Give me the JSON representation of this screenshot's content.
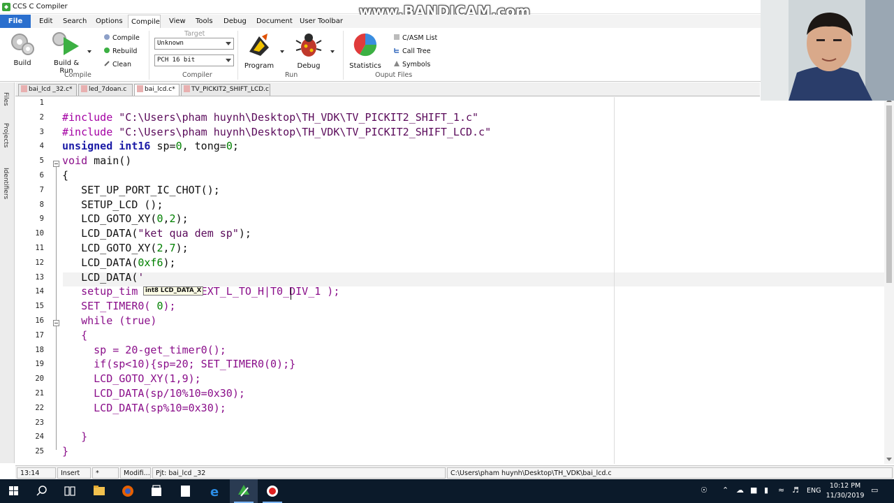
{
  "window": {
    "title": "CCS C Compiler",
    "watermark": "www.BANDICAM.com"
  },
  "menu": {
    "items": [
      {
        "label": "File"
      },
      {
        "label": "Edit"
      },
      {
        "label": "Search"
      },
      {
        "label": "Options"
      },
      {
        "label": "Compile"
      },
      {
        "label": "View"
      },
      {
        "label": "Tools"
      },
      {
        "label": "Debug"
      },
      {
        "label": "Document"
      },
      {
        "label": "User Toolbar"
      }
    ],
    "active": "Compile"
  },
  "ribbon": {
    "build": "Build",
    "build_run": "Build & Run",
    "compile": "Compile",
    "rebuild": "Rebuild",
    "clean": "Clean",
    "group_compile": "Compile",
    "target_label": "Target",
    "target_value": "Unknown",
    "compiler_value": "PCH 16 bit",
    "group_compiler": "Compiler",
    "program": "Program",
    "debug": "Debug",
    "group_run": "Run",
    "statistics": "Statistics",
    "casm_list": "C/ASM List",
    "call_tree": "Call Tree",
    "symbols": "Symbols",
    "group_output": "Ouput Files"
  },
  "tabs": [
    {
      "label": "bai_lcd _32.c*"
    },
    {
      "label": "led_7doan.c"
    },
    {
      "label": "bai_lcd.c*"
    },
    {
      "label": "TV_PICKIT2_SHIFT_LCD.c"
    }
  ],
  "dock": {
    "files": "Files",
    "projects": "Projects",
    "identifiers": "Identifiers"
  },
  "editor": {
    "line_numbers": [
      "1",
      "2",
      "3",
      "4",
      "5",
      "6",
      "7",
      "8",
      "9",
      "10",
      "11",
      "12",
      "13",
      "14",
      "15",
      "16",
      "17",
      "18",
      "19",
      "20",
      "21",
      "22",
      "23",
      "24",
      "25"
    ],
    "lines": [
      [],
      [
        {
          "c": "pp",
          "t": "#include "
        },
        {
          "c": "str",
          "t": "\"C:\\Users\\pham huynh\\Desktop\\TH_VDK\\TV_PICKIT2_SHIFT_1.c\""
        }
      ],
      [
        {
          "c": "pp",
          "t": "#include "
        },
        {
          "c": "str",
          "t": "\"C:\\Users\\pham huynh\\Desktop\\TH_VDK\\TV_PICKIT2_SHIFT_LCD.c\""
        }
      ],
      [
        {
          "c": "kw",
          "t": "unsigned int16"
        },
        {
          "c": "fn",
          "t": " sp="
        },
        {
          "c": "num",
          "t": "0"
        },
        {
          "c": "fn",
          "t": ", tong="
        },
        {
          "c": "num",
          "t": "0"
        },
        {
          "c": "fn",
          "t": ";"
        }
      ],
      [
        {
          "c": "mg",
          "t": "void"
        },
        {
          "c": "fn",
          "t": " main()"
        }
      ],
      [
        {
          "c": "fn",
          "t": "{"
        }
      ],
      [
        {
          "c": "fn",
          "t": "   SET_UP_PORT_IC_CHOT();"
        }
      ],
      [
        {
          "c": "fn",
          "t": "   SETUP_LCD ();"
        }
      ],
      [
        {
          "c": "fn",
          "t": "   LCD_GOTO_XY("
        },
        {
          "c": "num",
          "t": "0"
        },
        {
          "c": "fn",
          "t": ","
        },
        {
          "c": "num",
          "t": "2"
        },
        {
          "c": "fn",
          "t": ");"
        }
      ],
      [
        {
          "c": "fn",
          "t": "   LCD_DATA("
        },
        {
          "c": "str",
          "t": "\"ket qua dem sp\""
        },
        {
          "c": "fn",
          "t": ");"
        }
      ],
      [
        {
          "c": "fn",
          "t": "   LCD_GOTO_XY("
        },
        {
          "c": "num",
          "t": "2"
        },
        {
          "c": "fn",
          "t": ","
        },
        {
          "c": "num",
          "t": "7"
        },
        {
          "c": "fn",
          "t": ");"
        }
      ],
      [
        {
          "c": "fn",
          "t": "   LCD_DATA("
        },
        {
          "c": "num",
          "t": "0xf6"
        },
        {
          "c": "fn",
          "t": ");"
        }
      ],
      [
        {
          "c": "fn",
          "t": "   LCD_DATA("
        },
        {
          "c": "str",
          "t": "'"
        }
      ],
      [
        {
          "c": "mg",
          "t": "   setup_tim"
        },
        {
          "c": "mg",
          "t": "          EXT_L_TO_H|T0_DIV_1 );"
        }
      ],
      [
        {
          "c": "mg",
          "t": "   SET_TIMER0( "
        },
        {
          "c": "num",
          "t": "0"
        },
        {
          "c": "mg",
          "t": ");"
        }
      ],
      [
        {
          "c": "mg",
          "t": "   while (true)"
        }
      ],
      [
        {
          "c": "mg",
          "t": "   {"
        }
      ],
      [
        {
          "c": "mg",
          "t": "     sp = 20-get_timer0();"
        }
      ],
      [
        {
          "c": "mg",
          "t": "     if(sp<10){sp=20; SET_TIMER0(0);}"
        }
      ],
      [
        {
          "c": "mg",
          "t": "     LCD_GOTO_XY(1,9);"
        }
      ],
      [
        {
          "c": "mg",
          "t": "     LCD_DATA(sp/10%10=0x30);"
        }
      ],
      [
        {
          "c": "mg",
          "t": "     LCD_DATA(sp%10=0x30);"
        }
      ],
      [],
      [
        {
          "c": "mg",
          "t": "   }"
        }
      ],
      [
        {
          "c": "mg",
          "t": "}"
        }
      ]
    ],
    "tooltip": "int8 LCD_DATA_X"
  },
  "status": {
    "position": "13:14",
    "mode": "Insert",
    "modified_flag": "*",
    "modified": "Modifi...",
    "project": "Pjt: bai_lcd _32",
    "path": "C:\\Users\\pham huynh\\Desktop\\TH_VDK\\bai_lcd.c"
  },
  "taskbar": {
    "lang": "ENG",
    "time": "10:12 PM",
    "date": "11/30/2019"
  },
  "colors": {
    "accent": "#2a6fce",
    "preprocessor": "#a300a3",
    "keyword": "#1a1aa6",
    "number": "#008000",
    "taskbar": "#0b1a2a"
  }
}
